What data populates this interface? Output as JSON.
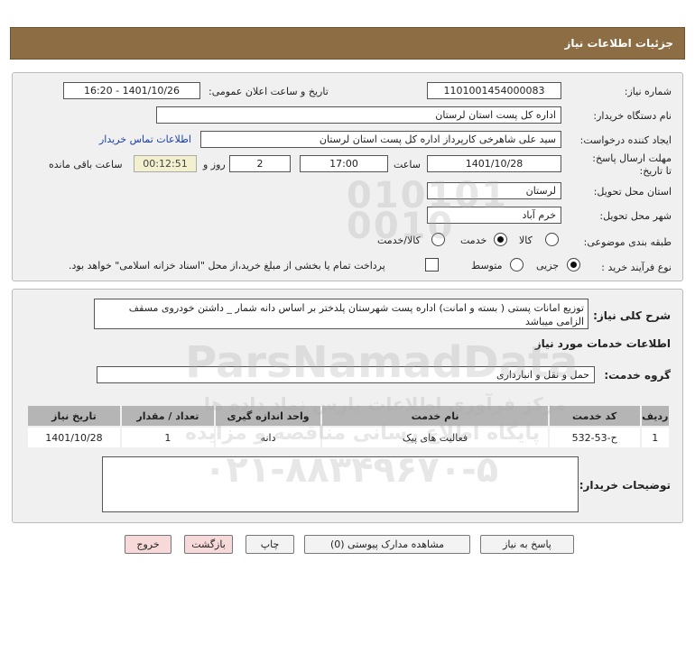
{
  "header": {
    "title": "جزئیات اطلاعات نیاز"
  },
  "form": {
    "need_number_label": "شماره نیاز:",
    "need_number": "1101001454000083",
    "announce_label": "تاریخ و ساعت اعلان عمومی:",
    "announce_value": "1401/10/26 - 16:20",
    "buyer_org_label": "نام دستگاه خریدار:",
    "buyer_org": "اداره کل پست استان لرستان",
    "requester_label": "ایجاد کننده درخواست:",
    "requester": "سید علی شاهرخی کارپرداز اداره کل پست استان لرستان",
    "contact_link": "اطلاعات تماس خریدار",
    "deadline_label": "مهلت ارسال پاسخ: تا تاریخ:",
    "deadline_date": "1401/10/28",
    "time_label": "ساعت",
    "deadline_time": "17:00",
    "days_value": "2",
    "days_label": "روز و",
    "remaining_time": "00:12:51",
    "remaining_label": "ساعت باقی مانده",
    "province_label": "استان محل تحویل:",
    "province": "لرستان",
    "city_label": "شهر محل تحویل:",
    "city": "خرم آباد",
    "category_label": "طبقه بندی موضوعی:",
    "category_options": [
      "کالا",
      "خدمت",
      "کالا/خدمت"
    ],
    "category_selected": "خدمت",
    "process_label": "نوع فرآیند خرید :",
    "process_options": [
      "جزیی",
      "متوسط"
    ],
    "process_selected": "جزیی",
    "payment_note": "پرداخت تمام یا بخشی از مبلغ خرید،از محل \"اسناد خزانه اسلامی\" خواهد بود."
  },
  "details": {
    "summary_label": "شرح کلی نیاز:",
    "summary": "توزیع امانات پستی ( بسته و امانت) اداره پست شهرستان پلدختر بر اساس دانه شمار _ داشتن خودروی مسقف الزامی میباشد",
    "services_title": "اطلاعات خدمات مورد نیاز",
    "service_group_label": "گروه خدمت:",
    "service_group": "حمل و نقل و انبارداری",
    "table": {
      "headers": [
        "ردیف",
        "کد خدمت",
        "نام خدمت",
        "واحد اندازه گیری",
        "تعداد / مقدار",
        "تاریخ نیاز"
      ],
      "rows": [
        [
          "1",
          "ح-53-532",
          "فعالیت های پیک",
          "دانه",
          "1",
          "1401/10/28"
        ]
      ]
    },
    "buyer_notes_label": "توضیحات خریدار:"
  },
  "buttons": {
    "reply": "پاسخ به نیاز",
    "attachments": "مشاهده مدارک پیوستی (0)",
    "print": "چاپ",
    "back": "بازگشت",
    "exit": "خروج"
  },
  "watermark": {
    "brand": "ParsNamadData",
    "line1": "مرکز فرآوری اطلاعات پارس نماد داده ها",
    "line2": "پایگاه اطلاع رسانی مناقصه و مزایده",
    "phone": "۰۲۱-۸۸۳۴۹۶۷۰-۵"
  }
}
